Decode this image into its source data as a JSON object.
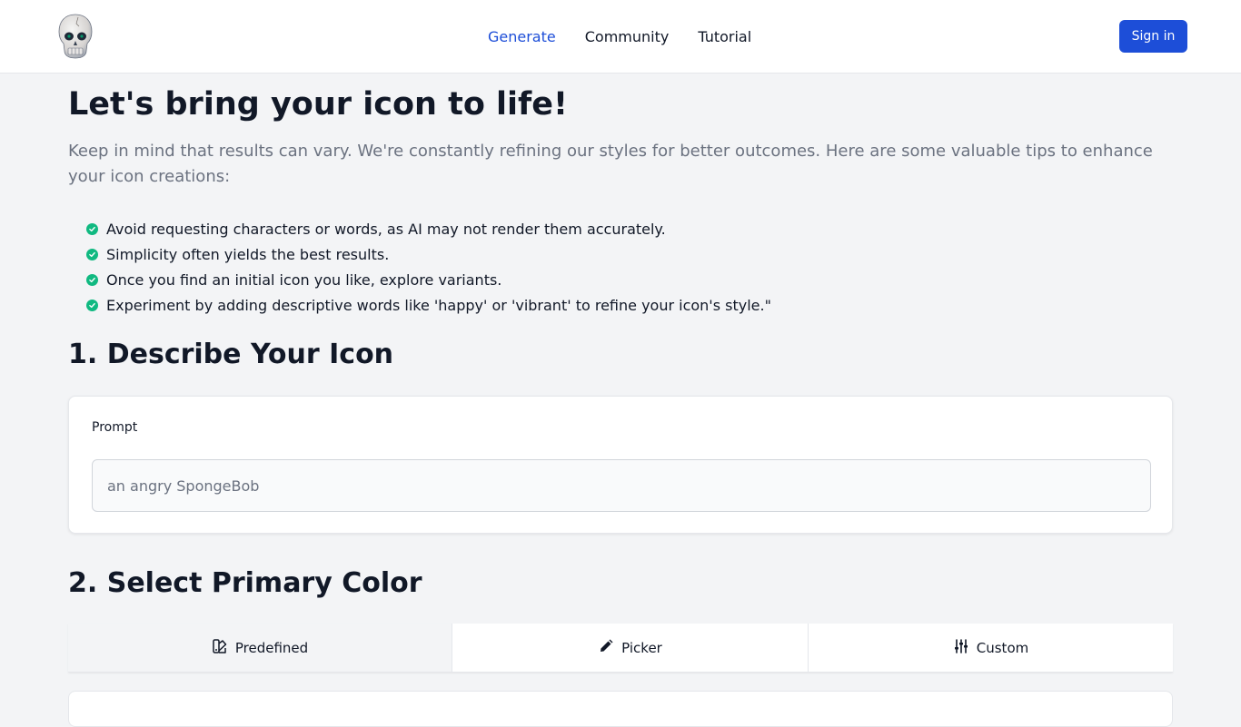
{
  "navbar": {
    "logo_icon": "skull-logo",
    "links": [
      {
        "label": "Generate",
        "active": true
      },
      {
        "label": "Community",
        "active": false
      },
      {
        "label": "Tutorial",
        "active": false
      }
    ],
    "signin_label": "Sign in"
  },
  "main": {
    "title": "Let's bring your icon to life!",
    "intro": "Keep in mind that results can vary. We're constantly refining our styles for better outcomes. Here are some valuable tips to enhance your icon creations:",
    "tips": [
      "Avoid requesting characters or words, as AI may not render them accurately.",
      "Simplicity often yields the best results.",
      "Once you find an initial icon you like, explore variants.",
      "Experiment by adding descriptive words like 'happy' or 'vibrant' to refine your icon's style.\""
    ],
    "tip_icon": "check-circle-icon"
  },
  "describe": {
    "title": "1. Describe Your Icon",
    "prompt_label": "Prompt",
    "prompt_placeholder": "an angry SpongeBob"
  },
  "color": {
    "title": "2. Select Primary Color",
    "tabs": [
      {
        "label": "Predefined",
        "icon": "palette-icon",
        "active": true
      },
      {
        "label": "Picker",
        "icon": "pencil-icon",
        "active": false
      },
      {
        "label": "Custom",
        "icon": "sliders-icon",
        "active": false
      }
    ]
  },
  "colors": {
    "accent": "#1d4ed8",
    "check": "#10b981",
    "background": "#f3f4f6"
  }
}
